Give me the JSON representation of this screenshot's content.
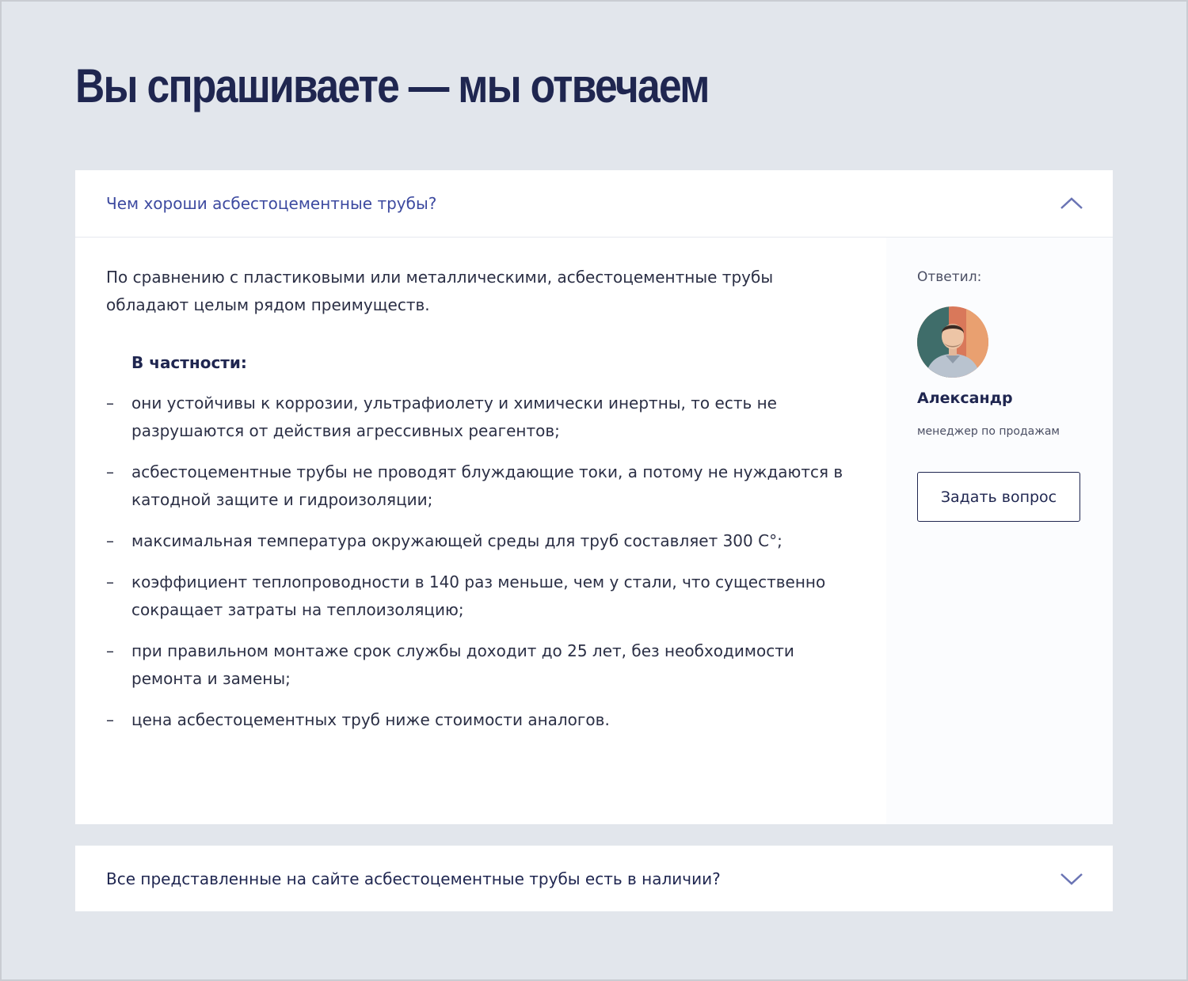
{
  "page": {
    "title": "Вы спрашиваете — мы отвечаем"
  },
  "faq": [
    {
      "question": "Чем хороши асбестоцементные трубы?",
      "expanded": true,
      "answer": {
        "intro": "По сравнению с пластиковыми или металлическими, асбестоцементные трубы обладают целым рядом преимуществ.",
        "subheading": "В частности:",
        "list_marker": "–",
        "items": [
          "они устойчивы к коррозии, ультрафиолету и химически инертны, то есть не разрушаются от действия агрессивных реагентов;",
          "асбестоцементные трубы не проводят блуждающие токи, а потому не нуждаются в катодной защите и гидроизоляции;",
          "максимальная температура окружающей среды для труб составляет 300 С°;",
          "коэффициент теплопроводности в 140 раз меньше, чем у стали, что существенно сокращает затраты на теплоизоляцию;",
          "при правильном монтаже срок службы доходит до 25 лет, без необходимости ремонта и замены;",
          "цена асбестоцементных труб ниже стоимости аналогов."
        ]
      },
      "answered_by": {
        "label": "Ответил:",
        "name": "Александр",
        "role": "менеджер по продажам",
        "avatar_icon": "user-avatar-photo"
      },
      "ask_button_label": "Задать вопрос",
      "toggle_icon": "chevron-up-icon"
    },
    {
      "question": "Все представленные на сайте асбестоцементные трубы есть в наличии?",
      "expanded": false,
      "toggle_icon": "chevron-down-icon"
    }
  ],
  "colors": {
    "background": "#e2e6ec",
    "card": "#ffffff",
    "heading": "#1f2650",
    "accent": "#3d4aa0",
    "chevron": "#6a74b4",
    "sidebar": "#fbfcfe"
  }
}
